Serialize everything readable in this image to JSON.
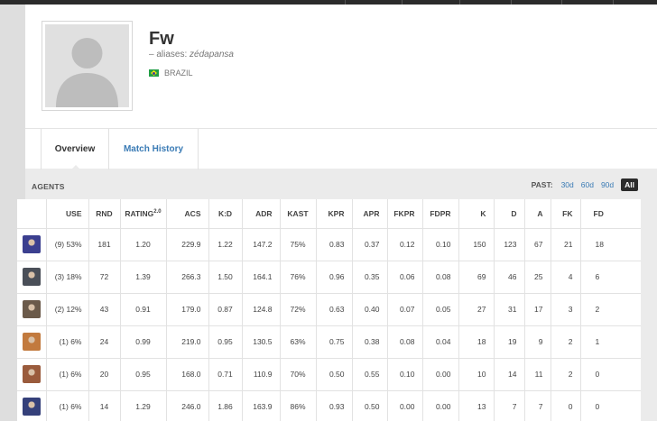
{
  "player": {
    "name": "Fw",
    "aliases_prefix": "– aliases: ",
    "aliases": "zédapansa",
    "country": "BRAZIL"
  },
  "tabs": {
    "overview": "Overview",
    "match_history": "Match History"
  },
  "agents_section": {
    "title": "AGENTS",
    "past_label": "PAST:",
    "filters": [
      "30d",
      "60d",
      "90d",
      "All"
    ]
  },
  "columns": {
    "use": "USE",
    "rnd": "RND",
    "rating": "RATING",
    "rating_sup": "2.0",
    "acs": "ACS",
    "kd": "K:D",
    "adr": "ADR",
    "kast": "KAST",
    "kpr": "KPR",
    "apr": "APR",
    "fkpr": "FKPR",
    "fdpr": "FDPR",
    "k": "K",
    "d": "D",
    "a": "A",
    "fk": "FK",
    "fd": "FD"
  },
  "rows": [
    {
      "icon": "agent-icon-1",
      "color": "#3b3f8f",
      "use": "(9) 53%",
      "rnd": "181",
      "rating": "1.20",
      "acs": "229.9",
      "kd": "1.22",
      "adr": "147.2",
      "kast": "75%",
      "kpr": "0.83",
      "apr": "0.37",
      "fkpr": "0.12",
      "fdpr": "0.10",
      "k": "150",
      "d": "123",
      "a": "67",
      "fk": "21",
      "fd": "18"
    },
    {
      "icon": "agent-icon-2",
      "color": "#4a4f58",
      "use": "(3) 18%",
      "rnd": "72",
      "rating": "1.39",
      "acs": "266.3",
      "kd": "1.50",
      "adr": "164.1",
      "kast": "76%",
      "kpr": "0.96",
      "apr": "0.35",
      "fkpr": "0.06",
      "fdpr": "0.08",
      "k": "69",
      "d": "46",
      "a": "25",
      "fk": "4",
      "fd": "6"
    },
    {
      "icon": "agent-icon-3",
      "color": "#6b5a4a",
      "use": "(2) 12%",
      "rnd": "43",
      "rating": "0.91",
      "acs": "179.0",
      "kd": "0.87",
      "adr": "124.8",
      "kast": "72%",
      "kpr": "0.63",
      "apr": "0.40",
      "fkpr": "0.07",
      "fdpr": "0.05",
      "k": "27",
      "d": "31",
      "a": "17",
      "fk": "3",
      "fd": "2"
    },
    {
      "icon": "agent-icon-4",
      "color": "#c27a3e",
      "use": "(1) 6%",
      "rnd": "24",
      "rating": "0.99",
      "acs": "219.0",
      "kd": "0.95",
      "adr": "130.5",
      "kast": "63%",
      "kpr": "0.75",
      "apr": "0.38",
      "fkpr": "0.08",
      "fdpr": "0.04",
      "k": "18",
      "d": "19",
      "a": "9",
      "fk": "2",
      "fd": "1"
    },
    {
      "icon": "agent-icon-5",
      "color": "#9a5b3c",
      "use": "(1) 6%",
      "rnd": "20",
      "rating": "0.95",
      "acs": "168.0",
      "kd": "0.71",
      "adr": "110.9",
      "kast": "70%",
      "kpr": "0.50",
      "apr": "0.55",
      "fkpr": "0.10",
      "fdpr": "0.00",
      "k": "10",
      "d": "14",
      "a": "11",
      "fk": "2",
      "fd": "0"
    },
    {
      "icon": "agent-icon-6",
      "color": "#35407a",
      "use": "(1) 6%",
      "rnd": "14",
      "rating": "1.29",
      "acs": "246.0",
      "kd": "1.86",
      "adr": "163.9",
      "kast": "86%",
      "kpr": "0.93",
      "apr": "0.50",
      "fkpr": "0.00",
      "fdpr": "0.00",
      "k": "13",
      "d": "7",
      "a": "7",
      "fk": "0",
      "fd": "0"
    }
  ]
}
